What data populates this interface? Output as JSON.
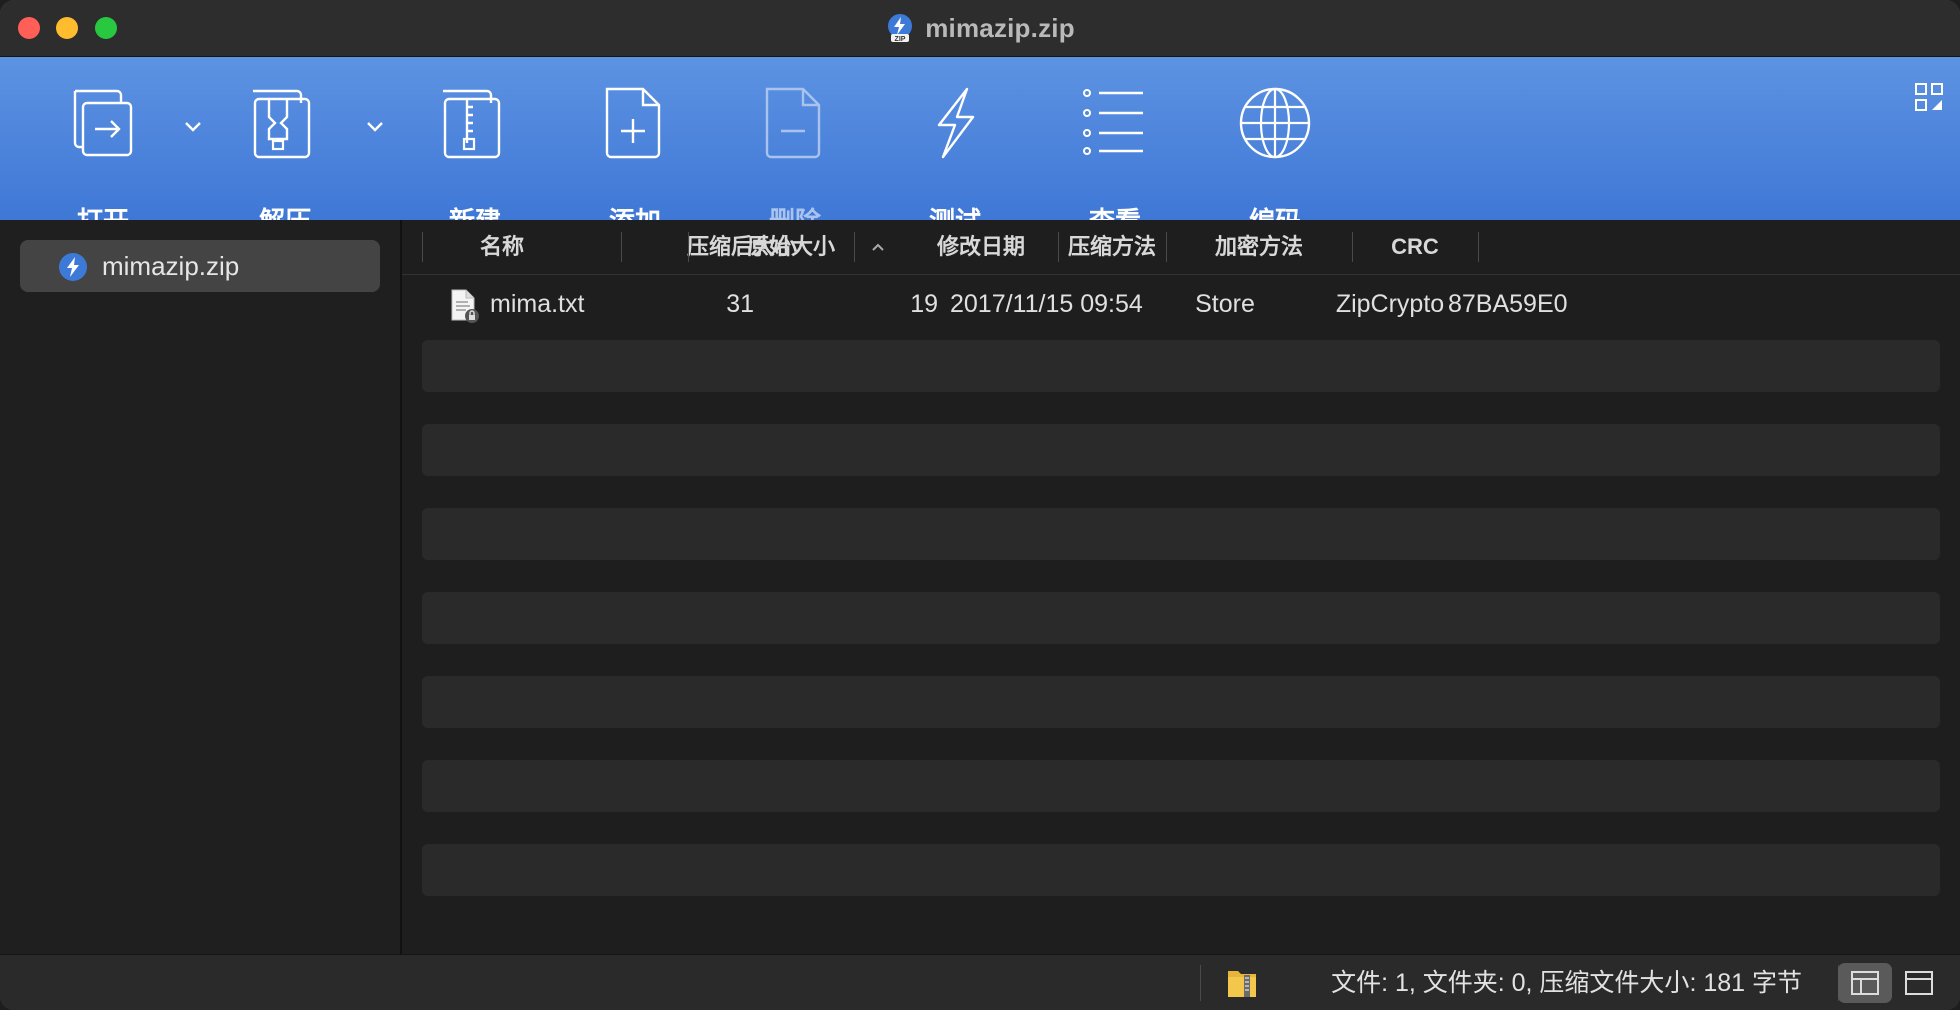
{
  "window": {
    "title": "mimazip.zip"
  },
  "toolbar": {
    "open": "打开",
    "extract": "解压",
    "new": "新建",
    "add": "添加",
    "delete": "删除",
    "test": "测试",
    "view": "查看",
    "encoding": "编码"
  },
  "sidebar": {
    "items": [
      {
        "label": "mimazip.zip"
      }
    ]
  },
  "table": {
    "columns": [
      "名称",
      "压缩后大小",
      "原始大小",
      "修改日期",
      "压缩方法",
      "加密方法",
      "CRC"
    ],
    "sort": {
      "column": "名称",
      "direction": "ascending"
    },
    "rows": [
      {
        "name": "mima.txt",
        "compressed": "31",
        "original": "19",
        "modified": "2017/11/15 09:54",
        "method": "Store",
        "encryption": "ZipCrypto",
        "crc": "87BA59E0",
        "locked": true
      }
    ]
  },
  "status": {
    "text": "文件: 1, 文件夹: 0, 压缩文件大小: 181 字节"
  },
  "colors": {
    "toolbar_top": "#5d93e2",
    "toolbar_bottom": "#3f77d6",
    "sidebar_selection": "#444444",
    "accent": "#3f77d6"
  },
  "icons": [
    "open-icon",
    "extract-icon",
    "new-archive-icon",
    "add-file-icon",
    "delete-file-icon",
    "test-lightning-icon",
    "view-list-icon",
    "encoding-globe-icon",
    "zip-archive-icon",
    "locked-file-icon",
    "folder-zip-icon"
  ]
}
